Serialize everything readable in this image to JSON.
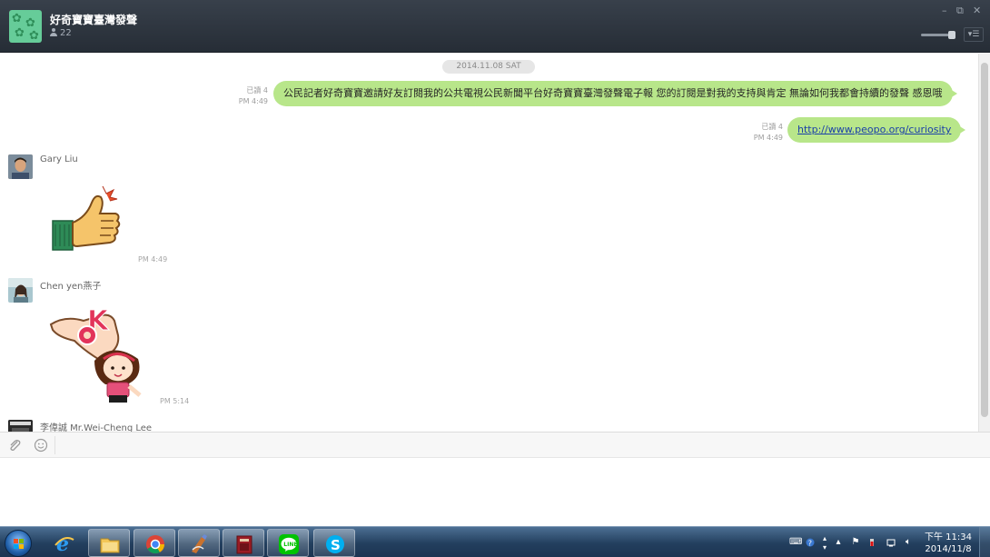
{
  "header": {
    "group_name": "好奇寶寶臺灣發聲",
    "member_count": "22",
    "icons": [
      "group-avatar",
      "person-icon",
      "minimize-icon",
      "restore-icon",
      "close-icon",
      "zoom-slider",
      "menu-icon"
    ]
  },
  "chat": {
    "date_divider": "2014.11.08 SAT",
    "outgoing": [
      {
        "read_label": "已讀 4",
        "time": "PM 4:49",
        "text": "公民記者好奇寶寶邀請好友訂閱我的公共電視公民新聞平台好奇寶寶臺灣發聲電子報 您的訂閱是對我的支持與肯定 無論如何我都會持續的發聲  感恩哦"
      },
      {
        "read_label": "已讀 4",
        "time": "PM 4:49",
        "link": "http://www.peopo.org/curiosity"
      }
    ],
    "incoming": [
      {
        "sender": "Gary Liu",
        "sticker": "thumbs-up-sticker",
        "time": "PM 4:49"
      },
      {
        "sender": "Chen yen燕子",
        "sticker": "ok-girl-sticker",
        "time": "PM 5:14"
      },
      {
        "sender": "李偉誠 Mr.Wei-Cheng Lee"
      }
    ]
  },
  "composer": {
    "icons": [
      "attach-icon",
      "emoji-icon"
    ]
  },
  "taskbar": {
    "apps": [
      "internet-explorer",
      "file-explorer",
      "chrome",
      "paint-app",
      "archive-app",
      "line-app",
      "skype-app"
    ],
    "active_app": "line-app",
    "tray_icons": [
      "keyboard",
      "help",
      "arrow-up",
      "flag",
      "power",
      "network",
      "volume"
    ],
    "clock_time": "下午 11:34",
    "clock_date": "2014/11/8"
  },
  "colors": {
    "header_bg": "#2c333d",
    "bubble_outgoing": "#b8e68a",
    "taskbar_bg": "#2a4a6c",
    "link": "#1a3fa8"
  }
}
